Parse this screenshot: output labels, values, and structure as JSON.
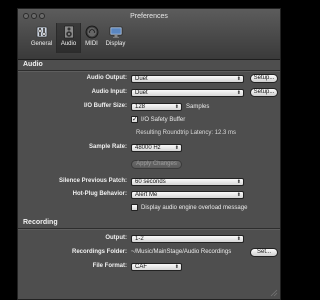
{
  "window": {
    "title": "Preferences"
  },
  "toolbar": {
    "items": [
      {
        "label": "General"
      },
      {
        "label": "Audio"
      },
      {
        "label": "MIDI"
      },
      {
        "label": "Display"
      }
    ]
  },
  "audio": {
    "section_title": "Audio",
    "output_label": "Audio Output:",
    "output_value": "Duet",
    "output_setup": "Setup...",
    "input_label": "Audio Input:",
    "input_value": "Duet",
    "input_setup": "Setup...",
    "buffer_label": "I/O Buffer Size:",
    "buffer_value": "128",
    "buffer_unit": "Samples",
    "safety_buffer_label": "I/O Safety Buffer",
    "safety_buffer_checked": true,
    "latency_text": "Resulting Roundtrip Latency: 12.3 ms",
    "sample_rate_label": "Sample Rate:",
    "sample_rate_value": "48000 Hz",
    "apply_label": "Apply Changes",
    "silence_label": "Silence Previous Patch:",
    "silence_value": "60 seconds",
    "hotplug_label": "Hot-Plug Behavior:",
    "hotplug_value": "Alert Me",
    "overload_label": "Display audio engine overload message",
    "overload_checked": false
  },
  "recording": {
    "section_title": "Recording",
    "output_label": "Output:",
    "output_value": "1-2",
    "folder_label": "Recordings Folder:",
    "folder_value": "~/Music/MainStage/Audio Recordings",
    "folder_set": "Set...",
    "format_label": "File Format:",
    "format_value": "CAF"
  },
  "colors": {
    "window_bg": "#4e4e4e",
    "titlebar": "#3a3a3a",
    "control_bg": "#f0f0f0"
  },
  "icons": [
    "switch-icon",
    "speaker-icon",
    "midi-icon",
    "display-icon",
    "popup-arrow-icon",
    "checkmark-icon",
    "resize-grip-icon"
  ]
}
